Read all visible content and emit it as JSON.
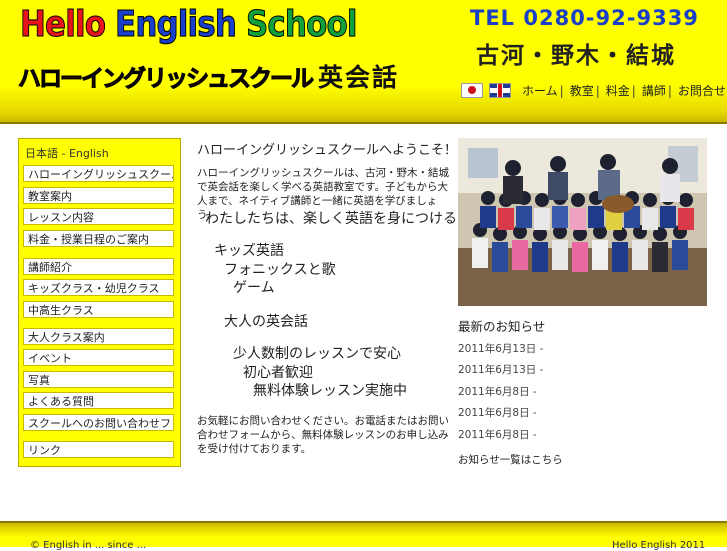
{
  "header": {
    "logo_words": [
      {
        "text": "Hello",
        "color": "c-red"
      },
      {
        "text": " English",
        "color": "c-blue"
      },
      {
        "text": " School",
        "color": "c-green"
      }
    ],
    "logo_kana": "ハローイングリッシュスクール",
    "logo_kana_suffix": "英会話",
    "tel": "TEL 0280-92-9339",
    "cities": "古河・野木・結城",
    "nav": [
      "ホーム",
      "教室",
      "料金",
      "講師",
      "お問合せ"
    ]
  },
  "sidebar": {
    "lang_label": "日本語",
    "lang_sep": " - ",
    "lang_alt": "English",
    "items": [
      "ハローイングリッシュスクールとは",
      "教室案内",
      "レッスン内容",
      "料金・授業日程のご案内",
      "講師紹介",
      "キッズクラス・幼児クラス",
      "中高生クラス",
      "大人クラス案内",
      "イベント",
      "写真",
      "よくある質問",
      "スクールへのお問い合わせフォーム",
      "リンク"
    ]
  },
  "main": {
    "title": "ハローイングリッシュスクールへようこそ！",
    "intro": "ハローイングリッシュスクールは、古河・野木・結城で英会話を楽しく学べる英語教室です。子どもから大人まで、ネイティブ講師と一緒に英語を学びましょう。",
    "lead": "わたしたちは、楽しく英語を身につけることを大切にしています。",
    "lines": [
      "キッズ英語",
      "フォニックスと歌",
      "ゲーム",
      "大人の英会話",
      "少人数制のレッスンで安心",
      "初心者歓迎",
      "無料体験レッスン実施中"
    ],
    "outro": "お気軽にお問い合わせください。お電話またはお問い合わせフォームから、無料体験レッスンのお申し込みを受け付けております。"
  },
  "news": {
    "title": "最新のお知らせ",
    "dates": [
      "2011年6月13日 -",
      "2011年6月13日 -",
      "2011年6月8日 -",
      "2011年6月8日 -",
      "2011年6月8日 -"
    ],
    "more": "お知らせ一覧はこちら"
  },
  "footer": {
    "left": "© English in ... since ...",
    "right": "Hello English 2011"
  }
}
